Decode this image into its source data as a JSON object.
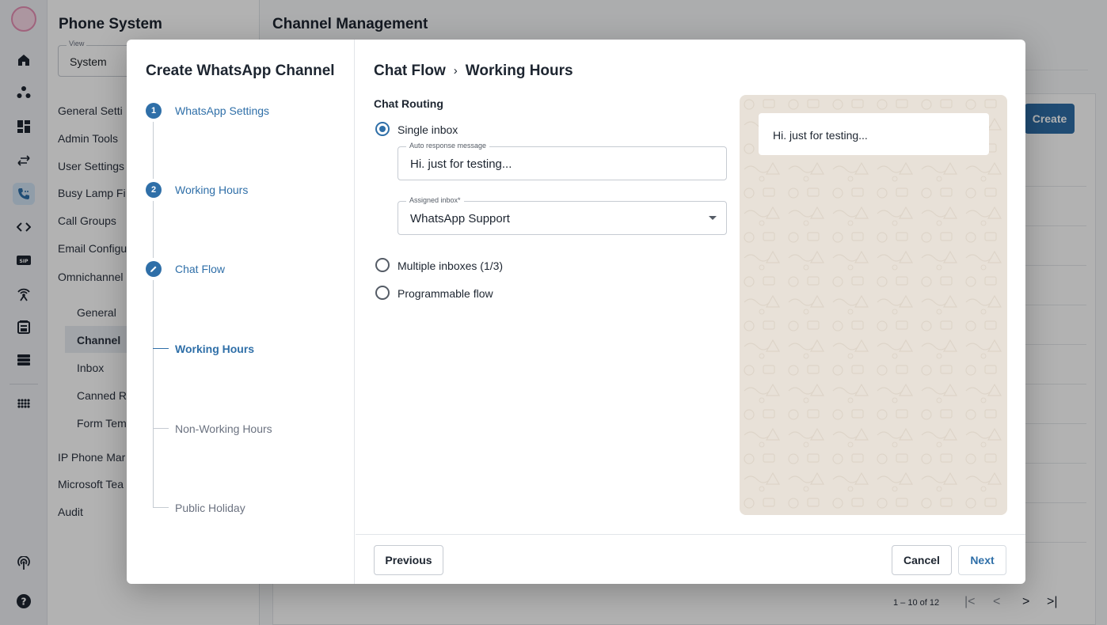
{
  "app": {
    "title": "Phone System",
    "view": {
      "label": "View",
      "value": "System"
    },
    "nav": [
      "General Setti",
      "Admin Tools",
      "User Settings",
      "Busy Lamp Fi",
      "Call Groups",
      "Email Configu",
      "Omnichannel"
    ],
    "omni_sub": [
      "General",
      "Channel",
      "Inbox",
      "Canned R",
      "Form Tem"
    ],
    "nav_bottom": [
      "IP Phone Mar",
      "Microsoft Tea",
      "Audit"
    ]
  },
  "main": {
    "title": "Channel Management",
    "create_label": "Create",
    "pager_text": "1 – 10 of 12"
  },
  "rail_icons": [
    "logo-icon",
    "home-icon",
    "org-icon",
    "dashboard-icon",
    "transfer-icon",
    "phone-icon",
    "code-icon",
    "sip-icon",
    "antenna-icon",
    "contacts-icon",
    "server-icon",
    "apps-icon",
    "broadcast-icon",
    "help-icon"
  ],
  "dialog": {
    "title": "Create WhatsApp Channel",
    "steps": [
      {
        "number": "1",
        "label": "WhatsApp Settings"
      },
      {
        "number": "2",
        "label": "Working Hours"
      },
      {
        "label": "Chat Flow"
      }
    ],
    "substeps": [
      "Working Hours",
      "Non-Working Hours",
      "Public Holiday"
    ],
    "breadcrumb": {
      "parent": "Chat Flow",
      "separator": "›",
      "current": "Working Hours"
    },
    "section_title": "Chat Routing",
    "options": [
      {
        "label": "Single inbox",
        "selected": true
      },
      {
        "label": "Multiple inboxes (1/3)",
        "selected": false
      },
      {
        "label": "Programmable flow",
        "selected": false
      }
    ],
    "auto_response": {
      "label": "Auto response message",
      "value": "Hi. just for testing..."
    },
    "assigned_inbox": {
      "label": "Assigned inbox*",
      "value": "WhatsApp Support"
    },
    "preview_message": "Hi. just for testing...",
    "buttons": {
      "previous": "Previous",
      "cancel": "Cancel",
      "next": "Next"
    }
  },
  "colors": {
    "accent": "#2f6fa8",
    "preview_bg": "#e8e1d8",
    "scrim": "rgba(0,0,0,0.30)"
  }
}
